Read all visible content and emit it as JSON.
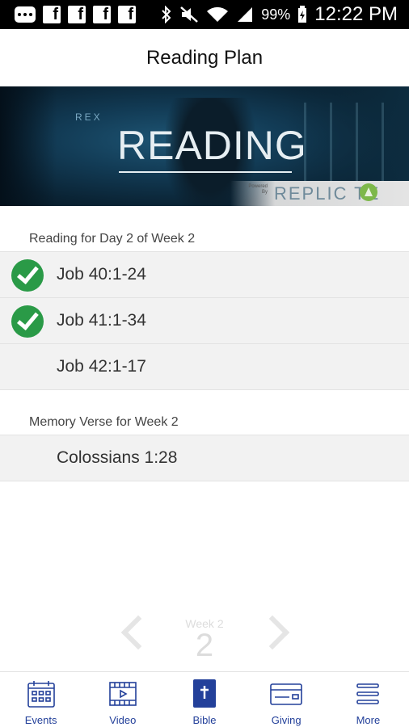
{
  "status_bar": {
    "battery": "99%",
    "time": "12:22 PM",
    "icons": [
      "messages-icon",
      "facebook-icon",
      "facebook-icon",
      "facebook-icon",
      "facebook-icon",
      "bluetooth-icon",
      "mute-icon",
      "wifi-icon",
      "signal-icon",
      "battery-icon"
    ]
  },
  "header": {
    "title": "Reading Plan"
  },
  "banner": {
    "side_text": "REX",
    "word": "READING",
    "powered_by": "Powered By",
    "brand": "REPLIC TE"
  },
  "reading": {
    "label": "Reading for Day 2 of Week 2",
    "items": [
      {
        "ref": "Job 40:1-24",
        "completed": true
      },
      {
        "ref": "Job 41:1-34",
        "completed": true
      },
      {
        "ref": "Job 42:1-17",
        "completed": false
      }
    ]
  },
  "memory": {
    "label": "Memory Verse for Week 2",
    "items": [
      {
        "ref": "Colossians 1:28"
      }
    ]
  },
  "pager": {
    "week_label": "Week 2",
    "week_number": "2"
  },
  "tabs": [
    {
      "label": "Events",
      "icon": "calendar-icon",
      "active": false
    },
    {
      "label": "Video",
      "icon": "video-icon",
      "active": false
    },
    {
      "label": "Bible",
      "icon": "bible-icon",
      "active": true
    },
    {
      "label": "Giving",
      "icon": "credit-card-icon",
      "active": false
    },
    {
      "label": "More",
      "icon": "menu-icon",
      "active": false
    }
  ],
  "colors": {
    "accent": "#23409a",
    "check": "#2a9a47",
    "list_bg": "#f2f2f2",
    "brand_leaf": "#7db84a"
  }
}
